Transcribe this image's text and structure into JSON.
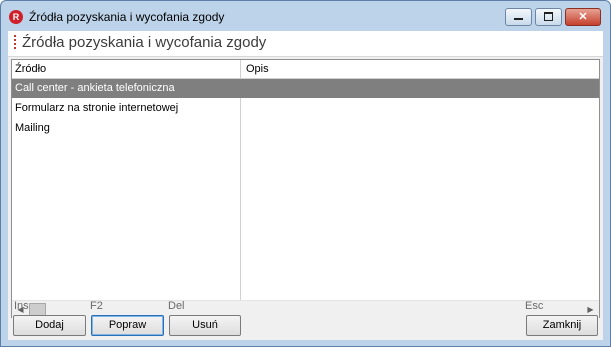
{
  "window": {
    "title": "Źródła pozyskania i wycofania zgody",
    "app_icon_letter": "R"
  },
  "header": {
    "title": "Źródła pozyskania i wycofania zgody"
  },
  "grid": {
    "columns": [
      "Źródło",
      "Opis"
    ],
    "rows": [
      {
        "zrodlo": "Call center - ankieta telefoniczna",
        "opis": ""
      },
      {
        "zrodlo": "Formularz na stronie internetowej",
        "opis": ""
      },
      {
        "zrodlo": "Mailing",
        "opis": ""
      }
    ],
    "selected_row": 0
  },
  "scrollbar": {
    "left_arrow": "◀",
    "right_arrow": "▶"
  },
  "buttons": {
    "add": {
      "label": "Dodaj",
      "shortcut": "Ins"
    },
    "edit": {
      "label": "Popraw",
      "shortcut": "F2"
    },
    "delete": {
      "label": "Usuń",
      "shortcut": "Del"
    },
    "close": {
      "label": "Zamknij",
      "shortcut": "Esc"
    }
  }
}
